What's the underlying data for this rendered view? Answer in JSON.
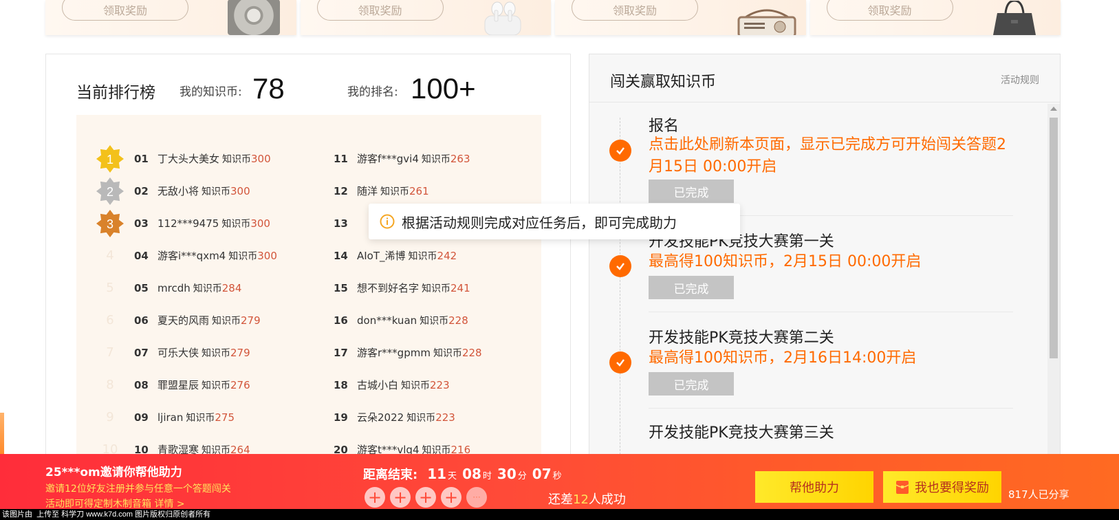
{
  "rewards": {
    "claim_label": "领取奖励",
    "prizes": [
      "safe-box",
      "earbuds",
      "retro-radio",
      "tote-bag"
    ]
  },
  "ranking": {
    "title": "当前排行榜",
    "my_coins_label": "我的知识币:",
    "my_coins_value": "78",
    "my_rank_label": "我的排名:",
    "my_rank_value": "100+",
    "unit": "知识币",
    "left_rows": [
      {
        "rank": "01",
        "name": "丁大头大美女",
        "score": "300",
        "medal": "1",
        "medal_color": "#f3c11b"
      },
      {
        "rank": "02",
        "name": "无敌小将",
        "score": "300",
        "medal": "2",
        "medal_color": "#b9b9b9"
      },
      {
        "rank": "03",
        "name": "112***9475",
        "score": "300",
        "medal": "3",
        "medal_color": "#d9822b"
      },
      {
        "rank": "04",
        "name": "游客i***qxm4",
        "score": "300",
        "ghost": "4"
      },
      {
        "rank": "05",
        "name": "mrcdh",
        "score": "284",
        "ghost": "5"
      },
      {
        "rank": "06",
        "name": "夏天的风雨",
        "score": "279",
        "ghost": "6"
      },
      {
        "rank": "07",
        "name": "可乐大侠",
        "score": "279",
        "ghost": "7"
      },
      {
        "rank": "08",
        "name": "罪盟星辰",
        "score": "276",
        "ghost": "8"
      },
      {
        "rank": "09",
        "name": "ljiran",
        "score": "275",
        "ghost": "9"
      },
      {
        "rank": "10",
        "name": "青歌湿寒",
        "score": "264",
        "ghost": "10"
      }
    ],
    "right_rows": [
      {
        "rank": "11",
        "name": "游客f***gvi4",
        "score": "263"
      },
      {
        "rank": "12",
        "name": "随洋",
        "score": "261"
      },
      {
        "rank": "13",
        "name": "",
        "score": ""
      },
      {
        "rank": "14",
        "name": "AIoT_浠博",
        "score": "242"
      },
      {
        "rank": "15",
        "name": "想不到好名字",
        "score": "241"
      },
      {
        "rank": "16",
        "name": "don***kuan",
        "score": "228"
      },
      {
        "rank": "17",
        "name": "游客r***gpmm",
        "score": "228"
      },
      {
        "rank": "18",
        "name": "古城小白",
        "score": "223"
      },
      {
        "rank": "19",
        "name": "云朵2022",
        "score": "223"
      },
      {
        "rank": "20",
        "name": "游客t***vlq4",
        "score": "216"
      }
    ]
  },
  "tooltip": {
    "text": "根据活动规则完成对应任务后，即可完成助力",
    "icon": "info-icon"
  },
  "stages": {
    "title": "闯关赢取知识币",
    "rules_link": "活动规则",
    "items": [
      {
        "name": "报名",
        "desc": "点击此处刷新本页面，显示已完成方可开始闯关答题2月15日 00:00开启",
        "button": "已完成"
      },
      {
        "name": "开发技能PK竞技大赛第一关",
        "desc": "最高得100知识币，2月15日 00:00开启",
        "button": "已完成"
      },
      {
        "name": "开发技能PK竞技大赛第二关",
        "desc": "最高得100知识币，2月16日14:00开启",
        "button": "已完成"
      },
      {
        "name": "开发技能PK竞技大赛第三关",
        "desc": "",
        "button": ""
      }
    ]
  },
  "bottom_bar": {
    "invite_title": "25***om邀请你帮他助力",
    "invite_desc": "邀请12位好友注册并参与任意一个答题闯关",
    "invite_desc2": "活动即可得定制木制音箱  详情 >",
    "countdown_label": "距离结束:",
    "days": "11",
    "days_unit": "天",
    "hours": "08",
    "hours_unit": "时",
    "minutes": "30",
    "minutes_unit": "分",
    "seconds": "07",
    "seconds_unit": "秒",
    "helper_plus": "+",
    "helper_more": "···",
    "remaining_prefix": "还差",
    "remaining_count": "12",
    "remaining_suffix": "人成功",
    "help_button": "帮他助力",
    "reward_button": "我也要得奖励",
    "share_count": "817人已分享"
  },
  "footer": {
    "text": "该图片由  上传至 科学刀 www.k7d.com 图片版权归原创者所有"
  },
  "colors": {
    "accent_orange": "#ff6a00",
    "score_red": "#d2553a",
    "bottom_red": "#ff2d3a",
    "button_yellow": "#ffe92a",
    "board_bg": "#fdf6ee"
  }
}
